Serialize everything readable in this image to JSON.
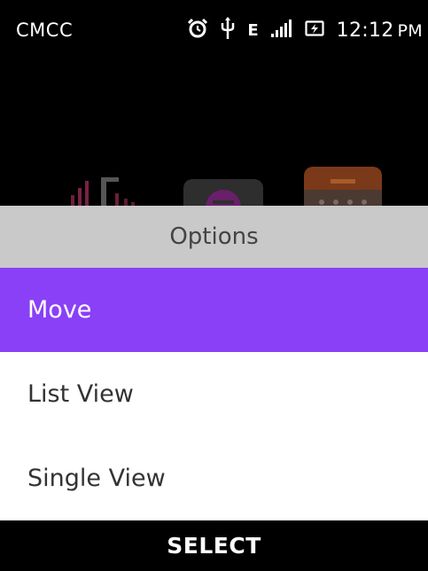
{
  "status_bar": {
    "carrier": "CMCC",
    "network_type": "E",
    "time": "12:12",
    "ampm": "PM",
    "icons": [
      "alarm-icon",
      "usb-icon",
      "signal-icon",
      "battery-charging-icon"
    ]
  },
  "background_apps": {
    "icons": [
      "music-app-icon",
      "radio-app-icon",
      "calendar-app-icon"
    ]
  },
  "options": {
    "title": "Options",
    "items": [
      {
        "label": "Move",
        "selected": true
      },
      {
        "label": "List View",
        "selected": false
      },
      {
        "label": "Single View",
        "selected": false
      }
    ]
  },
  "softkeys": {
    "center": "SELECT"
  },
  "colors": {
    "accent": "#8a40f6",
    "header_bg": "#c9c9c9"
  }
}
